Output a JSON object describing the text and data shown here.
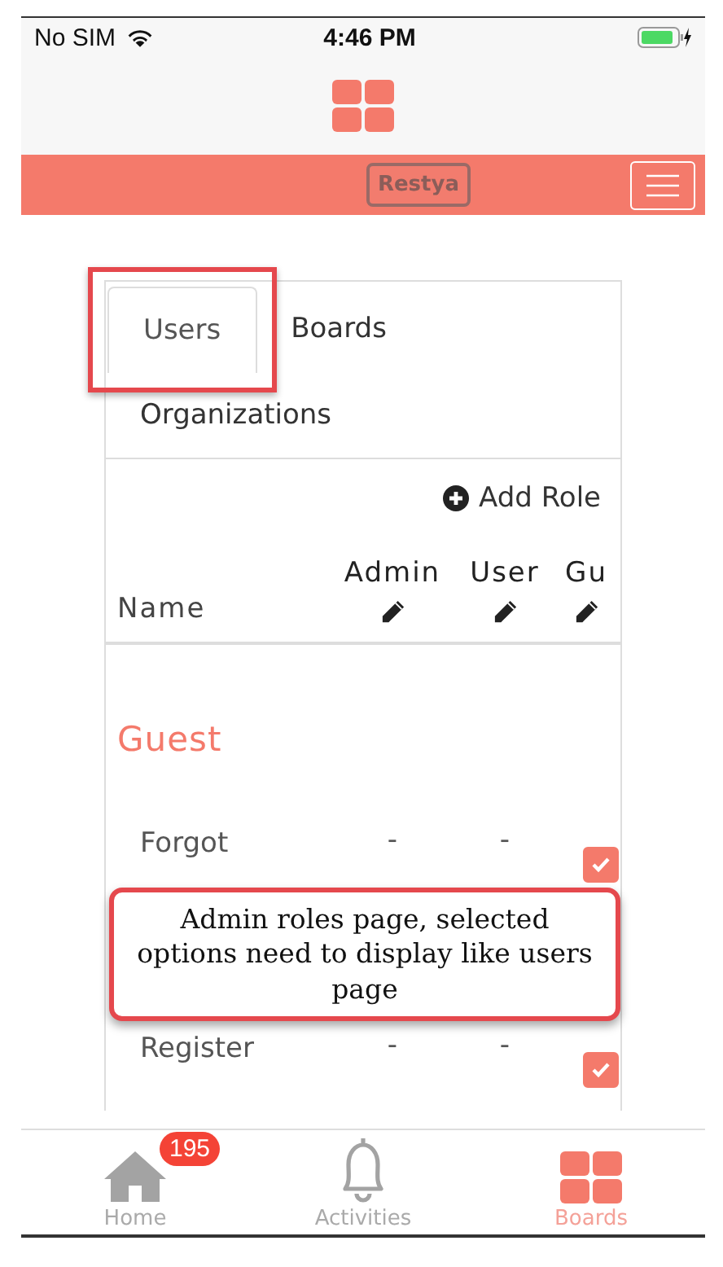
{
  "status_bar": {
    "carrier": "No SIM",
    "time": "4:46 PM"
  },
  "navbar": {
    "logo": "Restya"
  },
  "tabs": [
    {
      "label": "Users",
      "selected": true,
      "highlighted": true
    },
    {
      "label": "Boards",
      "selected": false,
      "highlighted": false
    },
    {
      "label": "Organizations",
      "selected": false,
      "highlighted": false
    }
  ],
  "add_role": "Add Role",
  "table": {
    "name_column": "Name",
    "role_columns": [
      {
        "label": "Admin"
      },
      {
        "label": "User"
      },
      {
        "label": "Gu"
      }
    ],
    "sections": [
      {
        "title": "Guest",
        "rows": [
          {
            "name": "Forgot",
            "cells": [
              {
                "kind": "text",
                "text": "-"
              },
              {
                "kind": "text",
                "text": "-"
              },
              {
                "kind": "checkbox",
                "checked": true
              }
            ]
          },
          {
            "name": "Register",
            "cells": [
              {
                "kind": "text",
                "text": "-"
              },
              {
                "kind": "text",
                "text": "-"
              },
              {
                "kind": "checkbox",
                "checked": true
              }
            ]
          }
        ]
      }
    ]
  },
  "callout": "Admin roles page, selected options need to display like users page",
  "tab_bar": [
    {
      "kind": "home",
      "label": "Home",
      "badge": "195",
      "selected": false
    },
    {
      "kind": "bell",
      "label": "Activities",
      "selected": false
    },
    {
      "kind": "boards",
      "label": "Boards",
      "selected": true
    }
  ]
}
